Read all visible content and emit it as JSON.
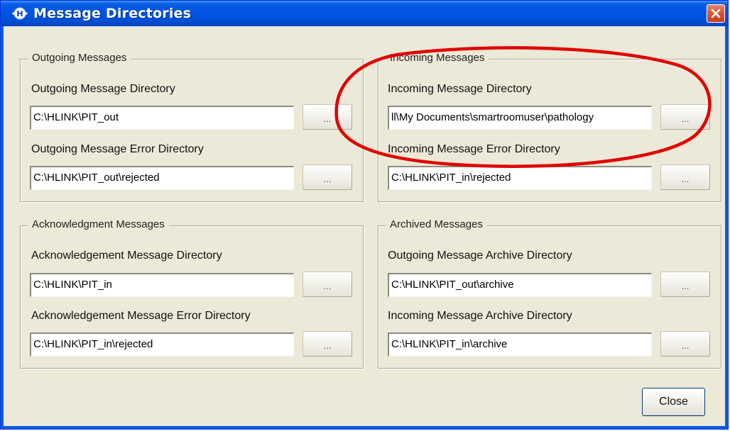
{
  "window": {
    "title": "Message Directories",
    "title_bar_color": "#0054e3",
    "close_icon": "close-x-icon"
  },
  "groups": {
    "outgoing": {
      "title": "Outgoing Messages",
      "fields": [
        {
          "label": "Outgoing Message Directory",
          "value": "C:\\HLINK\\PIT_out",
          "browse": "..."
        },
        {
          "label": "Outgoing Message Error Directory",
          "value": "C:\\HLINK\\PIT_out\\rejected",
          "browse": "..."
        }
      ]
    },
    "incoming": {
      "title": "Incoming Messages",
      "fields": [
        {
          "label": "Incoming Message Directory",
          "value": "ll\\My Documents\\smartroomuser\\pathology",
          "browse": "..."
        },
        {
          "label": "Incoming Message Error Directory",
          "value": "C:\\HLINK\\PIT_in\\rejected",
          "browse": "..."
        }
      ]
    },
    "acknowledgment": {
      "title": "Acknowledgment Messages",
      "fields": [
        {
          "label": "Acknowledgement Message Directory",
          "value": "C:\\HLINK\\PIT_in",
          "browse": "..."
        },
        {
          "label": "Acknowledgement Message Error Directory",
          "value": "C:\\HLINK\\PIT_in\\rejected",
          "browse": "..."
        }
      ]
    },
    "archived": {
      "title": "Archived Messages",
      "fields": [
        {
          "label": "Outgoing Message Archive Directory",
          "value": "C:\\HLINK\\PIT_out\\archive",
          "browse": "..."
        },
        {
          "label": "Incoming Message Archive Directory",
          "value": "C:\\HLINK\\PIT_in\\archive",
          "browse": "..."
        }
      ]
    }
  },
  "buttons": {
    "close": "Close"
  },
  "annotation": {
    "shape": "ellipse",
    "color": "#e00000"
  }
}
